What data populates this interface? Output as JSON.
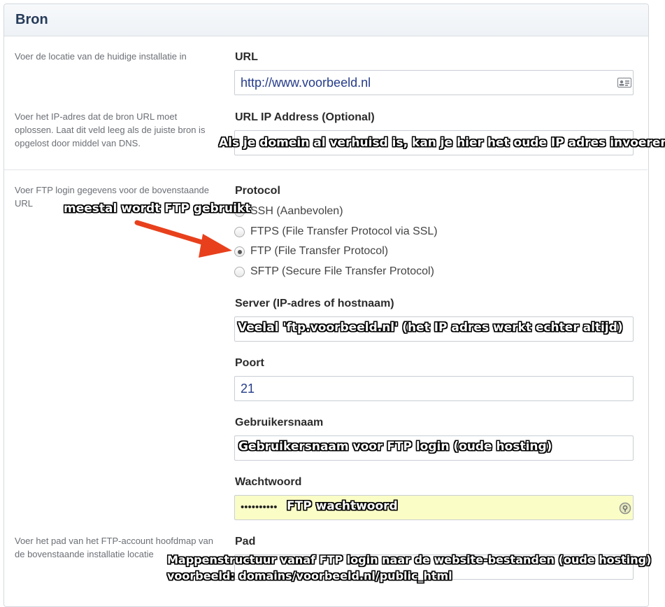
{
  "panel": {
    "title": "Bron"
  },
  "descriptions": {
    "url": "Voer de locatie van de huidige installatie in",
    "ip": "Voer het IP-adres dat de bron URL moet oplossen. Laat dit veld leeg als de juiste bron is opgelost door middel van DNS.",
    "ftp": "Voer FTP login gegevens voor de bovenstaande URL",
    "path": "Voer het pad van het FTP-account hoofdmap van de bovenstaande installatie locatie"
  },
  "fields": {
    "url": {
      "label": "URL",
      "value": "http://www.voorbeeld.nl"
    },
    "ip": {
      "label": "URL IP Address (Optional)",
      "value": ""
    },
    "protocol": {
      "label": "Protocol",
      "options": [
        "SSH (Aanbevolen)",
        "FTPS (File Transfer Protocol via SSL)",
        "FTP (File Transfer Protocol)",
        "SFTP (Secure File Transfer Protocol)"
      ],
      "selected": "FTP (File Transfer Protocol)"
    },
    "server": {
      "label": "Server (IP-adres of hostnaam)",
      "value": ""
    },
    "port": {
      "label": "Poort",
      "value": "21"
    },
    "username": {
      "label": "Gebruikersnaam",
      "value": ""
    },
    "password": {
      "label": "Wachtwoord",
      "value": "••••••••••"
    },
    "path": {
      "label": "Pad",
      "value": ""
    }
  },
  "annotations": {
    "ip_note": "Als je domein al verhuisd is, kan je hier het oude IP adres invoeren",
    "protocol_note": "meestal wordt FTP gebruikt",
    "server_note": "Veelal 'ftp.voorbeeld.nl' (het IP adres werkt echter altijd)",
    "username_note": "Gebruikersnaam voor FTP login (oude hosting)",
    "password_note": "FTP wachtwoord",
    "path_note_line1": "Mappenstructuur vanaf FTP login naar de website-bestanden (oude hosting)",
    "path_note_line2": "voorbeeld: domains/voorbeeld.nl/public_html"
  },
  "colors": {
    "arrow": "#e8401c",
    "accent": "#253b8a",
    "password_bg": "#fafdc6"
  },
  "icons": {
    "url_field": "contact-card-icon",
    "password_field": "password-key-icon"
  }
}
